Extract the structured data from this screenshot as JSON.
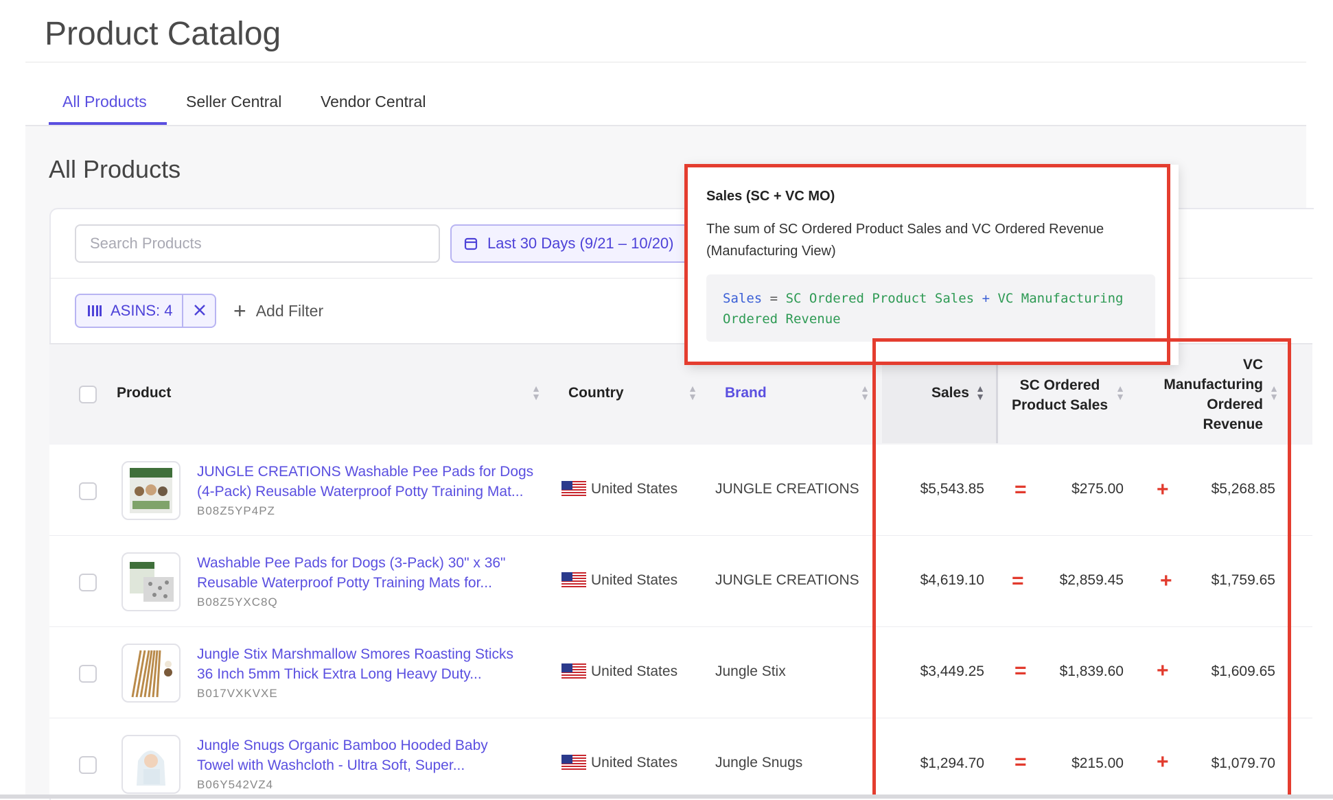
{
  "page": {
    "title": "Product Catalog"
  },
  "tabs": [
    {
      "label": "All Products",
      "active": true
    },
    {
      "label": "Seller Central",
      "active": false
    },
    {
      "label": "Vendor Central",
      "active": false
    }
  ],
  "section": {
    "title": "All Products"
  },
  "search": {
    "placeholder": "Search Products"
  },
  "date_range": {
    "label": "Last 30 Days (9/21 – 10/20)",
    "icon": "calendar-icon"
  },
  "filters": {
    "chip_label": "ASINS: 4",
    "chip_icon": "columns-icon",
    "add_filter_label": "Add Filter"
  },
  "table": {
    "headers": {
      "product": "Product",
      "country": "Country",
      "brand": "Brand",
      "sales": "Sales",
      "sc_line1": "SC Ordered",
      "sc_line2": "Product Sales",
      "vc_line1": "VC",
      "vc_line2": "Manufacturing",
      "vc_line3": "Ordered",
      "vc_line4": "Revenue"
    },
    "equals_symbol": "=",
    "plus_symbol": "+",
    "rows": [
      {
        "title_line1": "JUNGLE CREATIONS Washable Pee Pads for Dogs",
        "title_line2": "(4-Pack) Reusable Waterproof Potty Training Mat...",
        "asin": "B08Z5YP4PZ",
        "country": "United States",
        "brand": "JUNGLE CREATIONS",
        "sales": "$5,543.85",
        "sc_sales": "$275.00",
        "vc_revenue": "$5,268.85"
      },
      {
        "title_line1": "Washable Pee Pads for Dogs (3-Pack) 30\" x 36\"",
        "title_line2": "Reusable Waterproof Potty Training Mats for...",
        "asin": "B08Z5YXC8Q",
        "country": "United States",
        "brand": "JUNGLE CREATIONS",
        "sales": "$4,619.10",
        "sc_sales": "$2,859.45",
        "vc_revenue": "$1,759.65"
      },
      {
        "title_line1": "Jungle Stix Marshmallow Smores Roasting Sticks",
        "title_line2": "36 Inch 5mm Thick Extra Long Heavy Duty...",
        "asin": "B017VXKVXE",
        "country": "United States",
        "brand": "Jungle Stix",
        "sales": "$3,449.25",
        "sc_sales": "$1,839.60",
        "vc_revenue": "$1,609.65"
      },
      {
        "title_line1": "Jungle Snugs Organic Bamboo Hooded Baby",
        "title_line2": "Towel with Washcloth - Ultra Soft, Super...",
        "asin": "B06Y542VZ4",
        "country": "United States",
        "brand": "Jungle Snugs",
        "sales": "$1,294.70",
        "sc_sales": "$215.00",
        "vc_revenue": "$1,079.70"
      }
    ]
  },
  "tooltip": {
    "title": "Sales (SC + VC MO)",
    "description": "The sum of SC Ordered Product Sales and VC Ordered Revenue (Manufacturing View)",
    "formula_var": "Sales",
    "formula_eq": "=",
    "formula_part1": "SC Ordered Product Sales",
    "formula_plus": "+",
    "formula_part2": "VC Manufacturing",
    "formula_part3": "Ordered Revenue"
  },
  "colors": {
    "accent": "#5a4fe0",
    "highlight": "#e43d2f"
  }
}
